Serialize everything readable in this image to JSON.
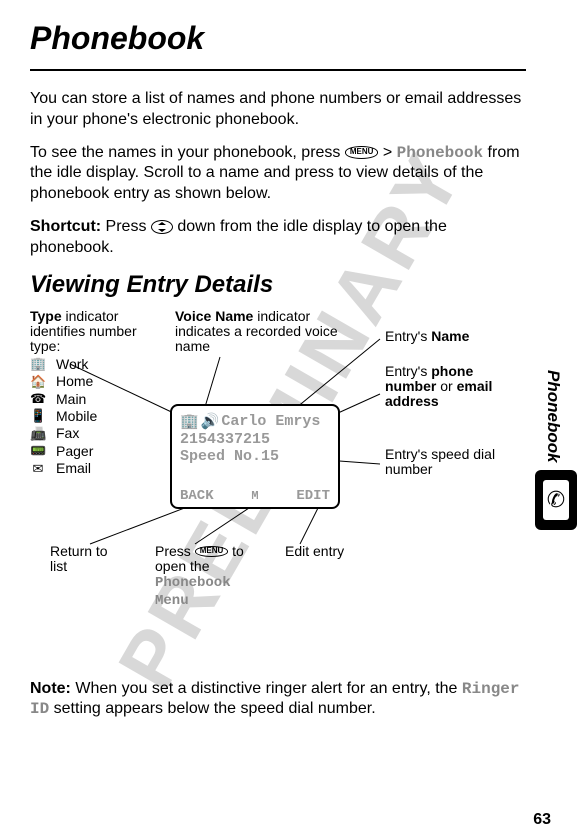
{
  "watermark": "PRELIMINARY",
  "title": "Phonebook",
  "intro_para": "You can store a list of names and phone numbers or email addresses in your phone's electronic phonebook.",
  "press_para_1": "To see the names in your phonebook, press",
  "press_para_2": " > ",
  "press_phonebook": "Phonebook",
  "press_para_3": " from the idle display. Scroll to a name and press to view details of the phonebook entry as shown below.",
  "shortcut_label": "Shortcut:",
  "shortcut_text_1": " Press ",
  "shortcut_text_2": " down from the idle display to open the phonebook.",
  "section_heading": "Viewing Entry Details",
  "type_annot": {
    "head1": "Type",
    "head2": " indicator identifies number type:",
    "items": [
      {
        "icon": "🏢",
        "label": "Work"
      },
      {
        "icon": "🏠",
        "label": "Home"
      },
      {
        "icon": "☎",
        "label": "Main"
      },
      {
        "icon": "📱",
        "label": "Mobile"
      },
      {
        "icon": "📠",
        "label": "Fax"
      },
      {
        "icon": "📟",
        "label": "Pager"
      },
      {
        "icon": "✉",
        "label": "Email"
      }
    ]
  },
  "voice_annot": {
    "head": "Voice Name",
    "rest": " indicator indicates a recorded voice name"
  },
  "entry_name_label": {
    "pre": "Entry's ",
    "bold": "Name"
  },
  "entry_phone_label": {
    "pre": "Entry's ",
    "bold1": "phone number",
    "mid": " or ",
    "bold2": "email address"
  },
  "entry_speed_label": "Entry's speed dial number",
  "screen": {
    "name": "Carlo Emrys",
    "number": "2154337215",
    "speed": "Speed No.15",
    "left_soft": "BACK",
    "right_soft": "EDIT",
    "menu_label": "M"
  },
  "menu_btn_text": "MENU",
  "return_label": "Return to list",
  "press_menu_1": "Press ",
  "press_menu_2": " to open the ",
  "press_menu_target": "Phonebook Menu",
  "edit_label": "Edit entry",
  "note_label": "Note:",
  "note_text_1": " When you set a distinctive ringer alert for an entry, the ",
  "note_ringer": "Ringer ID",
  "note_text_2": " setting appears below the speed dial number.",
  "side_label": "Phonebook",
  "page_number": "63"
}
